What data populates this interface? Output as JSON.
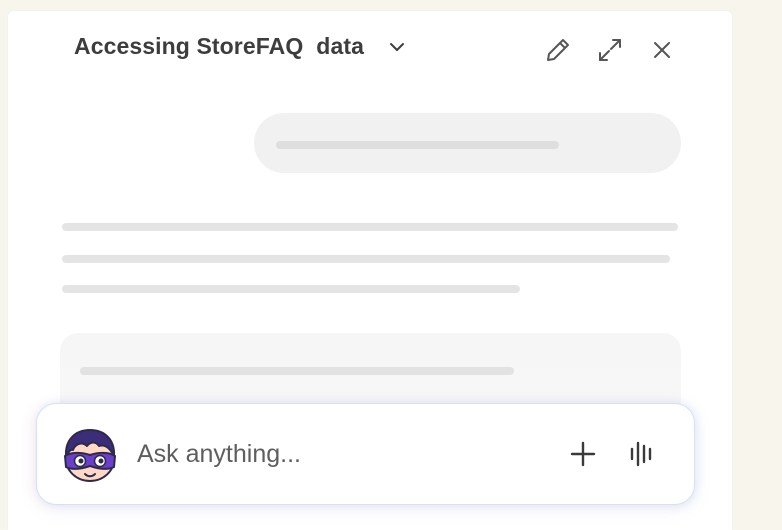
{
  "header": {
    "title": "Accessing StoreFAQ  data",
    "title_dropdown_icon": "chevron-down-icon",
    "actions": [
      {
        "name": "edit",
        "icon": "pencil-icon"
      },
      {
        "name": "expand",
        "icon": "expand-icon"
      },
      {
        "name": "close",
        "icon": "close-icon"
      }
    ]
  },
  "composer": {
    "placeholder": "Ask anything...",
    "avatar_icon": "masked-bot-avatar",
    "actions": [
      {
        "name": "add",
        "icon": "plus-icon"
      },
      {
        "name": "voice",
        "icon": "voice-bars-icon"
      }
    ]
  },
  "colors": {
    "background": "#f8f6ec",
    "panel": "#ffffff",
    "skeleton": "#e4e4e4",
    "avatar_mask": "#6a3fc9",
    "avatar_hair": "#3b2d7a",
    "icon": "#4a4a4a"
  }
}
